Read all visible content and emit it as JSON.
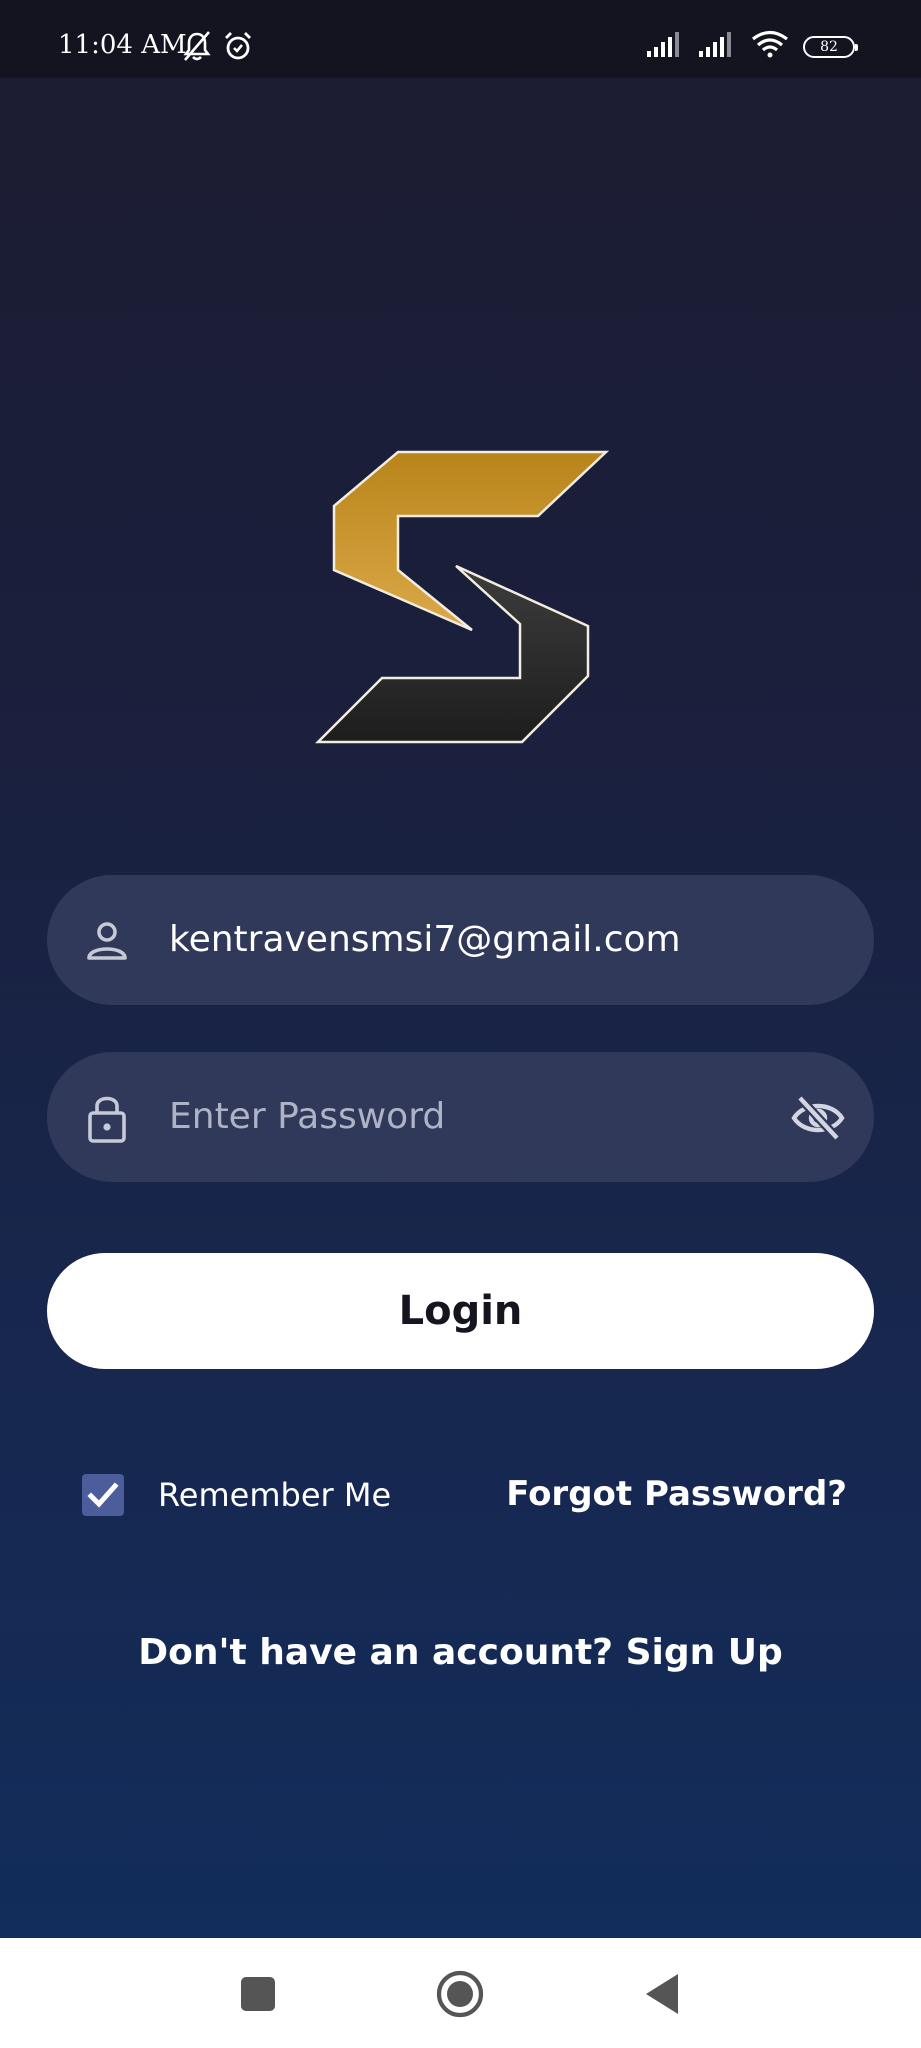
{
  "status_bar": {
    "time": "11:04 AM",
    "battery_level": "82",
    "icons": [
      "bell-off-icon",
      "alarm-icon",
      "signal-icon",
      "signal-icon",
      "wifi-icon",
      "battery-icon"
    ]
  },
  "logo": {
    "name": "S logo",
    "colors": {
      "gold_top": "#c08a1e",
      "gold_bottom": "#d9a542",
      "dark_top": "#3a3a3a",
      "dark_bottom": "#1c1c1c"
    }
  },
  "login_form": {
    "email_value": "kentravensmsi7@gmail.com",
    "password_placeholder": "Enter Password",
    "login_label": "Login",
    "remember_me_label": "Remember Me",
    "remember_me_checked": true,
    "forgot_password_label": "Forgot Password?",
    "signup_prompt": "Don't have an account? Sign Up"
  },
  "nav_bar": {
    "buttons": [
      "recents-button",
      "home-button",
      "back-button"
    ]
  },
  "colors": {
    "field_bg": "#31395a",
    "button_bg": "#ffffff",
    "checkbox_bg": "#4b5e9b",
    "bg_top": "#1c1c30",
    "bg_bottom": "#122d5b"
  }
}
